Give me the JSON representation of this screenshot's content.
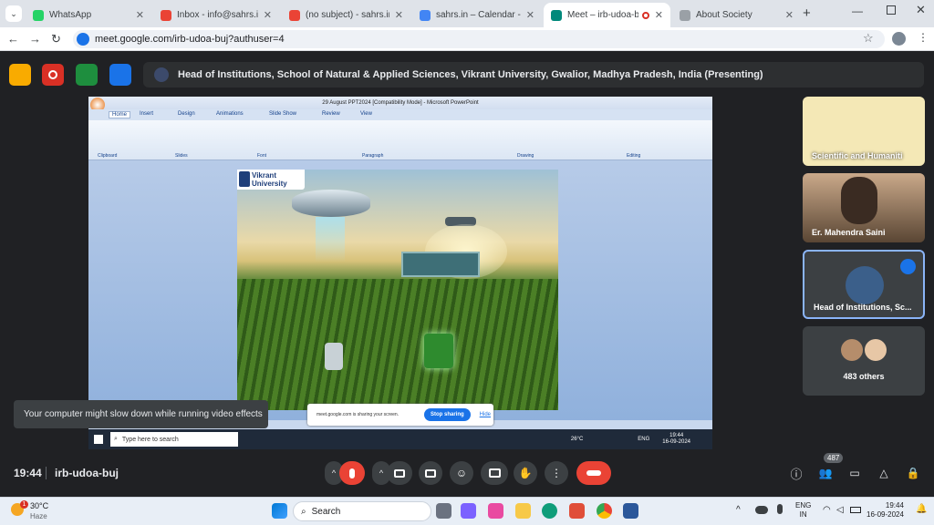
{
  "browser": {
    "tabs": [
      {
        "label": "WhatsApp",
        "color": "#25d366"
      },
      {
        "label": "Inbox - info@sahrs.in - sah",
        "color": "#ea4335"
      },
      {
        "label": "(no subject) - sahrs.india@",
        "color": "#ea4335"
      },
      {
        "label": "sahrs.in – Calendar - Mond",
        "color": "#4285f4"
      },
      {
        "label": "Meet – irb-udoa-buj",
        "color": "#00897b"
      },
      {
        "label": "About Society",
        "color": "#9aa0a6"
      }
    ],
    "url": "meet.google.com/irb-udoa-buj?authuser=4"
  },
  "meet": {
    "presenting_banner": "Head of Institutions, School of Natural & Applied Sciences, Vikrant University, Gwalior, Madhya Pradesh, India (Presenting)",
    "time": "19:44",
    "meeting_code": "irb-udoa-buj",
    "people_count": "487",
    "toast": "Your computer might slow down while running video effects"
  },
  "participants": [
    {
      "name": "Scientific and Humaniti"
    },
    {
      "name": "Er. Mahendra Saini"
    },
    {
      "name": "Head of Institutions, Sc..."
    },
    {
      "name": "483 others"
    }
  ],
  "shared_screen": {
    "window_title": "29 August PPT2024 [Compatibility Mode] - Microsoft PowerPoint",
    "ribbon_tabs": [
      "Home",
      "Insert",
      "Design",
      "Animations",
      "Slide Show",
      "Review",
      "View"
    ],
    "ribbon_groups": [
      "Clipboard",
      "Slides",
      "Font",
      "Paragraph",
      "Drawing",
      "Editing"
    ],
    "slide_logo": "Vikrant University",
    "share_notice": "meet.google.com is sharing your screen.",
    "stop_sharing": "Stop sharing",
    "hide": "Hide",
    "search_placeholder": "Type here to search",
    "temp": "26°C",
    "lang": "ENG",
    "clock_time": "19:44",
    "clock_date": "16-09-2024"
  },
  "taskbar": {
    "weather_temp": "30°C",
    "weather_desc": "Haze",
    "search_placeholder": "Search",
    "lang1": "ENG",
    "lang2": "IN",
    "time": "19:44",
    "date": "16-09-2024",
    "notif_badge": "1"
  }
}
